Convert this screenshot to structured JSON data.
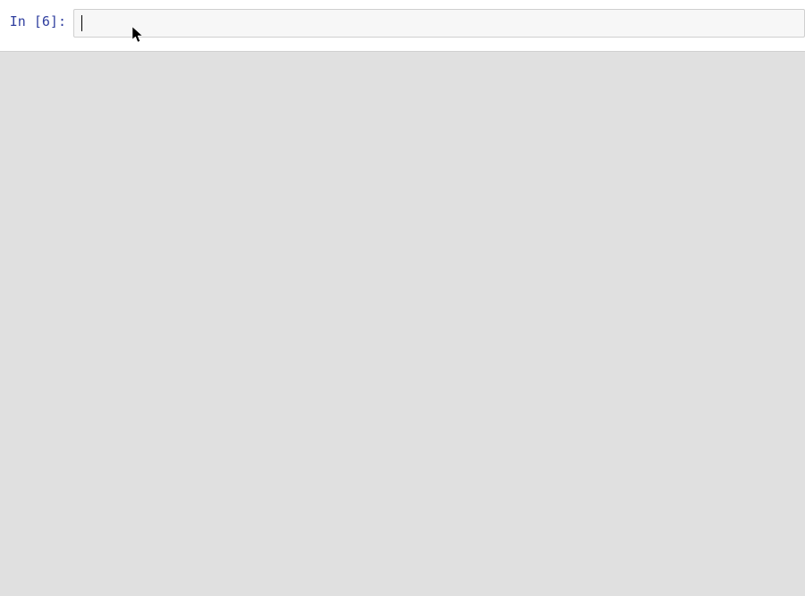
{
  "cell": {
    "prompt_label": "In [6]:",
    "input_value": ""
  }
}
